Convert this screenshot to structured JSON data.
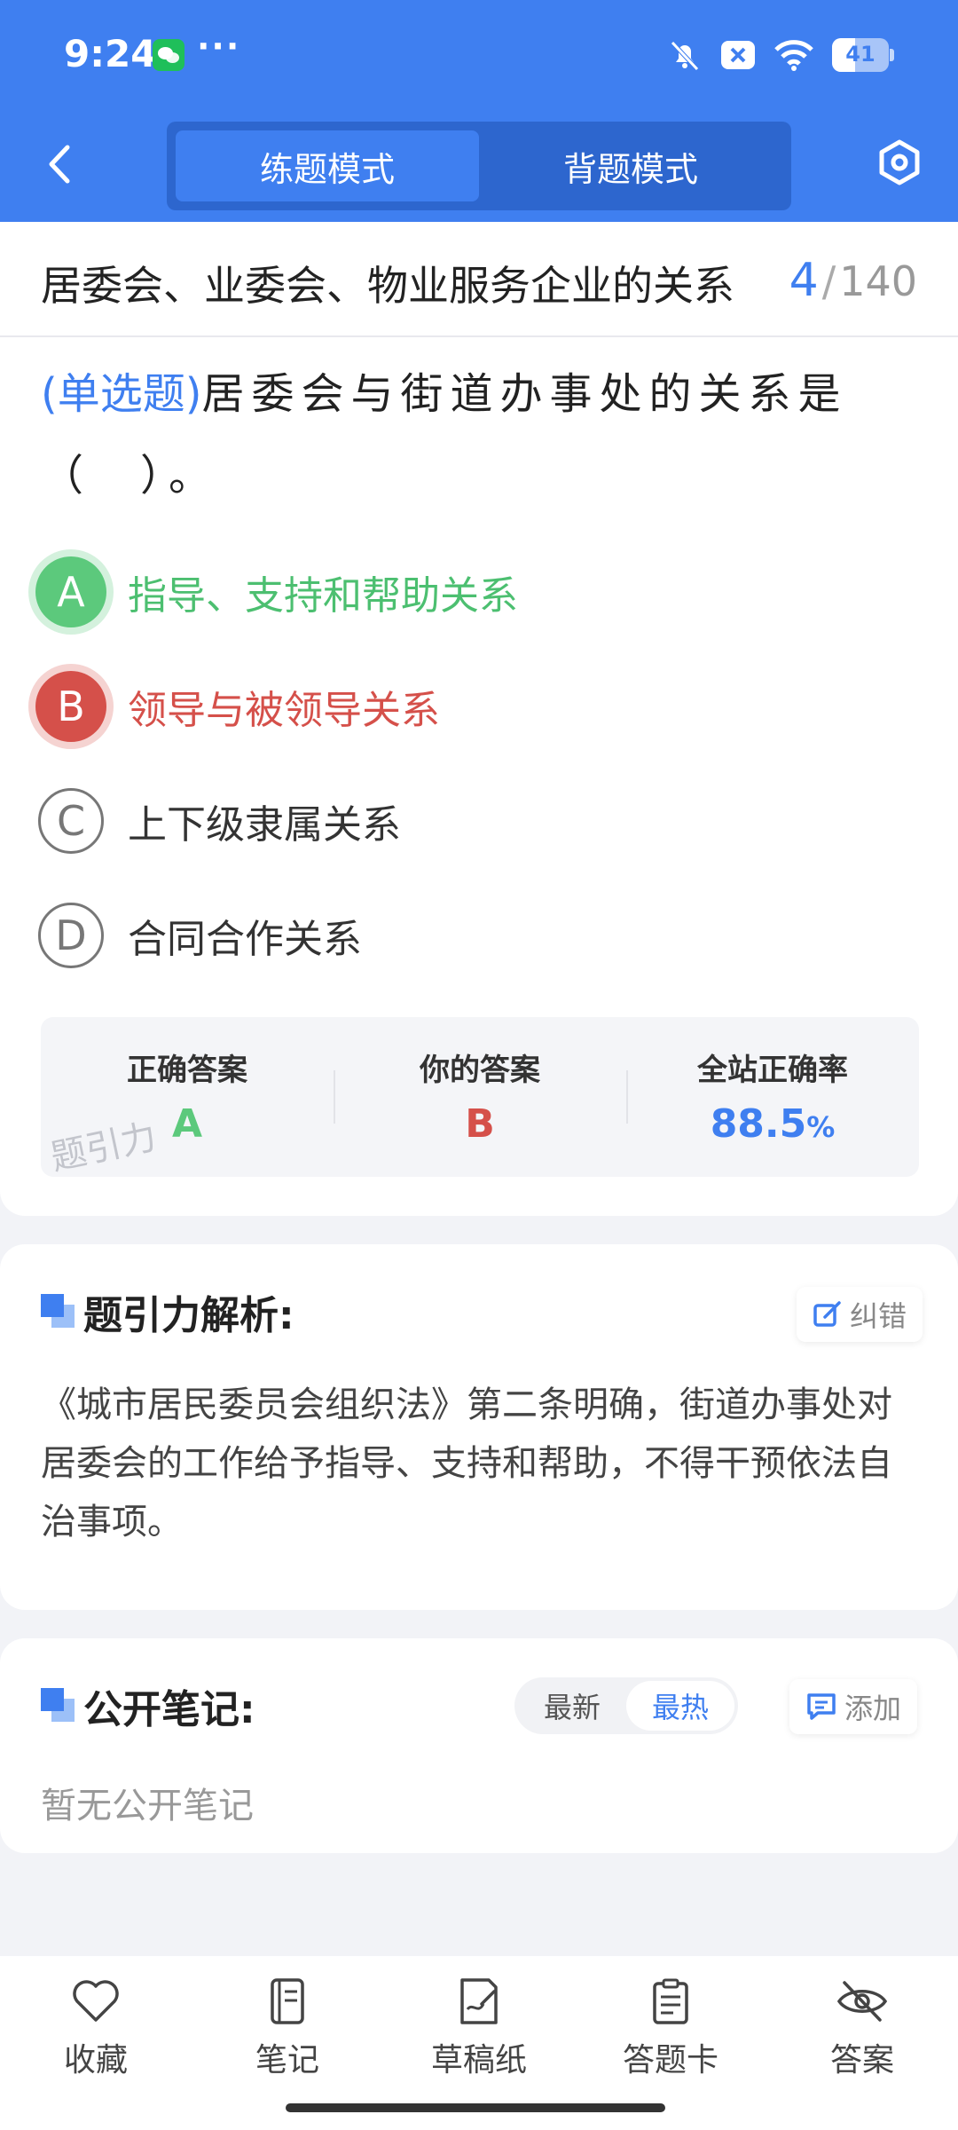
{
  "status_bar": {
    "time": "9:24",
    "more": "···",
    "battery_level": "41",
    "icons": [
      "wechat-icon",
      "bell-off-icon",
      "x-box-icon",
      "wifi-icon",
      "battery-icon"
    ]
  },
  "nav": {
    "tabs": [
      "练题模式",
      "背题模式"
    ],
    "active_tab": 0,
    "icons": [
      "back-icon",
      "settings-hex-icon"
    ]
  },
  "chapter": {
    "title": "居委会、业委会、物业服务企业的关系",
    "current": "4",
    "separator": "/",
    "total": "140"
  },
  "question": {
    "type": "(单选题)",
    "text": "居委会与街道办事处的关系是（　）。",
    "options": [
      {
        "letter": "A",
        "text": "指导、支持和帮助关系",
        "state": "correct"
      },
      {
        "letter": "B",
        "text": "领导与被领导关系",
        "state": "wrong"
      },
      {
        "letter": "C",
        "text": "上下级隶属关系",
        "state": "normal"
      },
      {
        "letter": "D",
        "text": "合同合作关系",
        "state": "normal"
      }
    ]
  },
  "answer_box": {
    "correct_label": "正确答案",
    "correct_value": "A",
    "mine_label": "你的答案",
    "mine_value": "B",
    "rate_label": "全站正确率",
    "rate_value": "88.5",
    "rate_unit": "%",
    "watermark": "题引力"
  },
  "analysis": {
    "title": "题引力解析:",
    "report_label": "纠错",
    "body": "《城市居民委员会组织法》第二条明确，街道办事处对居委会的工作给予指导、支持和帮助，不得干预依法自治事项。"
  },
  "notes": {
    "title": "公开笔记:",
    "sort": [
      "最新",
      "最热"
    ],
    "active_sort": 1,
    "add_label": "添加",
    "empty": "暂无公开笔记"
  },
  "bottom_nav": {
    "items": [
      {
        "label": "收藏",
        "icon": "heart-icon"
      },
      {
        "label": "笔记",
        "icon": "notebook-icon"
      },
      {
        "label": "草稿纸",
        "icon": "draft-paper-icon"
      },
      {
        "label": "答题卡",
        "icon": "answer-sheet-icon"
      },
      {
        "label": "答案",
        "icon": "eye-off-icon"
      }
    ]
  },
  "colors": {
    "primary": "#3f7ff0",
    "correct": "#5cc97c",
    "wrong": "#d5504a"
  }
}
